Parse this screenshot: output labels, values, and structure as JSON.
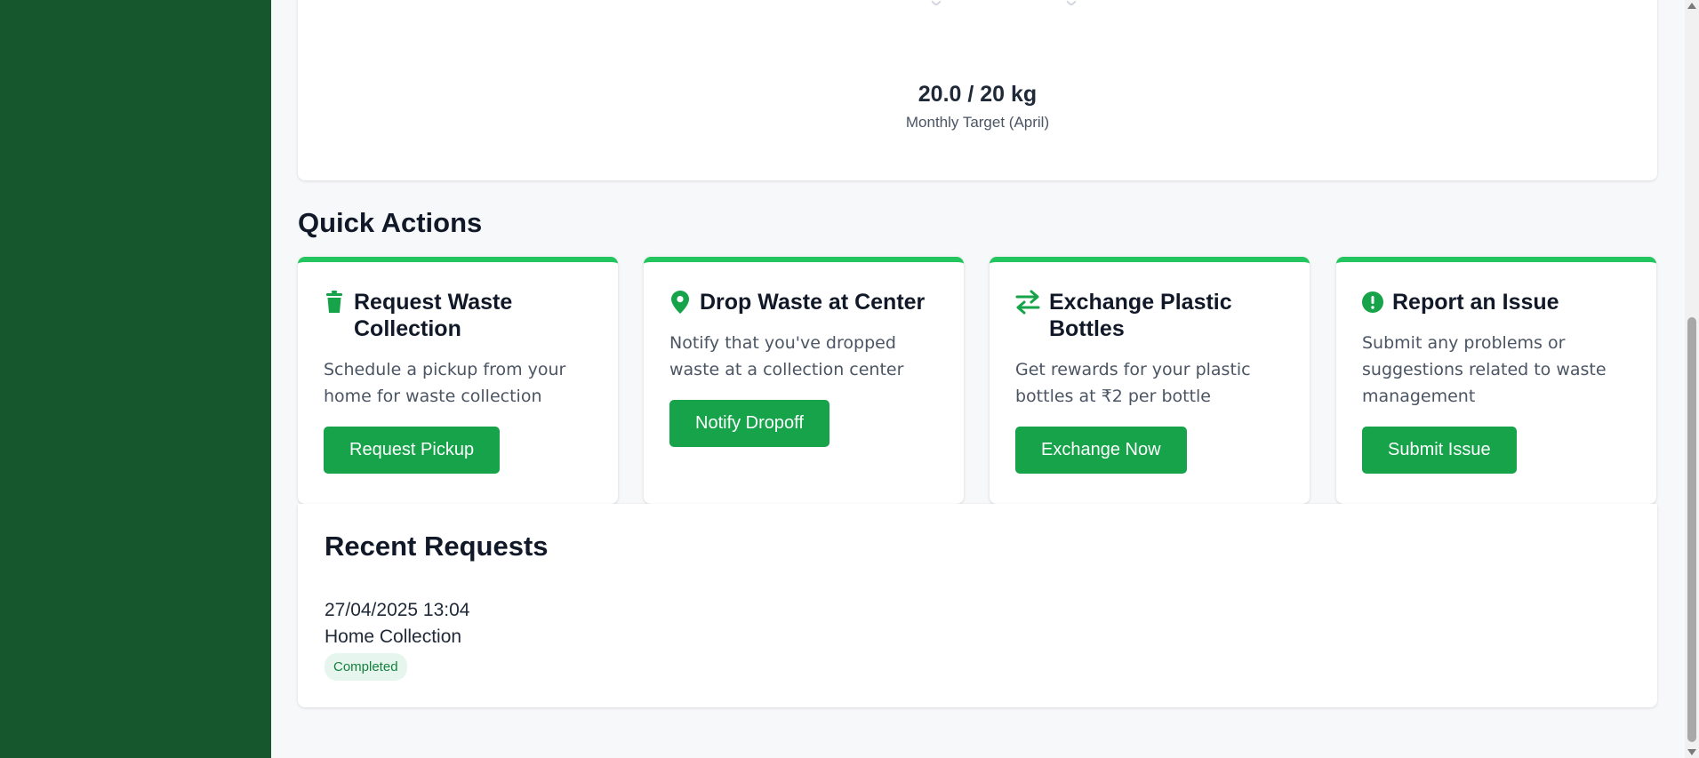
{
  "colors": {
    "sidebar": "#17572e",
    "accent": "#16a34a",
    "card_top_border": "#22c55e",
    "badge_bg": "#e6f6ee",
    "badge_text": "#15803d"
  },
  "target": {
    "value": "20.0 / 20 kg",
    "label": "Monthly Target (April)",
    "progress_fraction": 1.0
  },
  "quick_actions": {
    "title": "Quick Actions",
    "cards": [
      {
        "icon": "trash-icon",
        "title": "Request Waste Collection",
        "description": "Schedule a pickup from your home for waste collection",
        "button": "Request Pickup"
      },
      {
        "icon": "location-pin-icon",
        "title": "Drop Waste at Center",
        "description": "Notify that you've dropped waste at a collection center",
        "button": "Notify Dropoff"
      },
      {
        "icon": "exchange-arrows-icon",
        "title": "Exchange Plastic Bottles",
        "description": "Get rewards for your plastic bottles at ₹2 per bottle",
        "button": "Exchange Now"
      },
      {
        "icon": "alert-circle-icon",
        "title": "Report an Issue",
        "description": "Submit any problems or suggestions related to waste management",
        "button": "Submit Issue"
      }
    ]
  },
  "recent_requests": {
    "title": "Recent Requests",
    "items": [
      {
        "date": "27/04/2025 13:04",
        "type": "Home Collection",
        "status": "Completed"
      }
    ]
  }
}
